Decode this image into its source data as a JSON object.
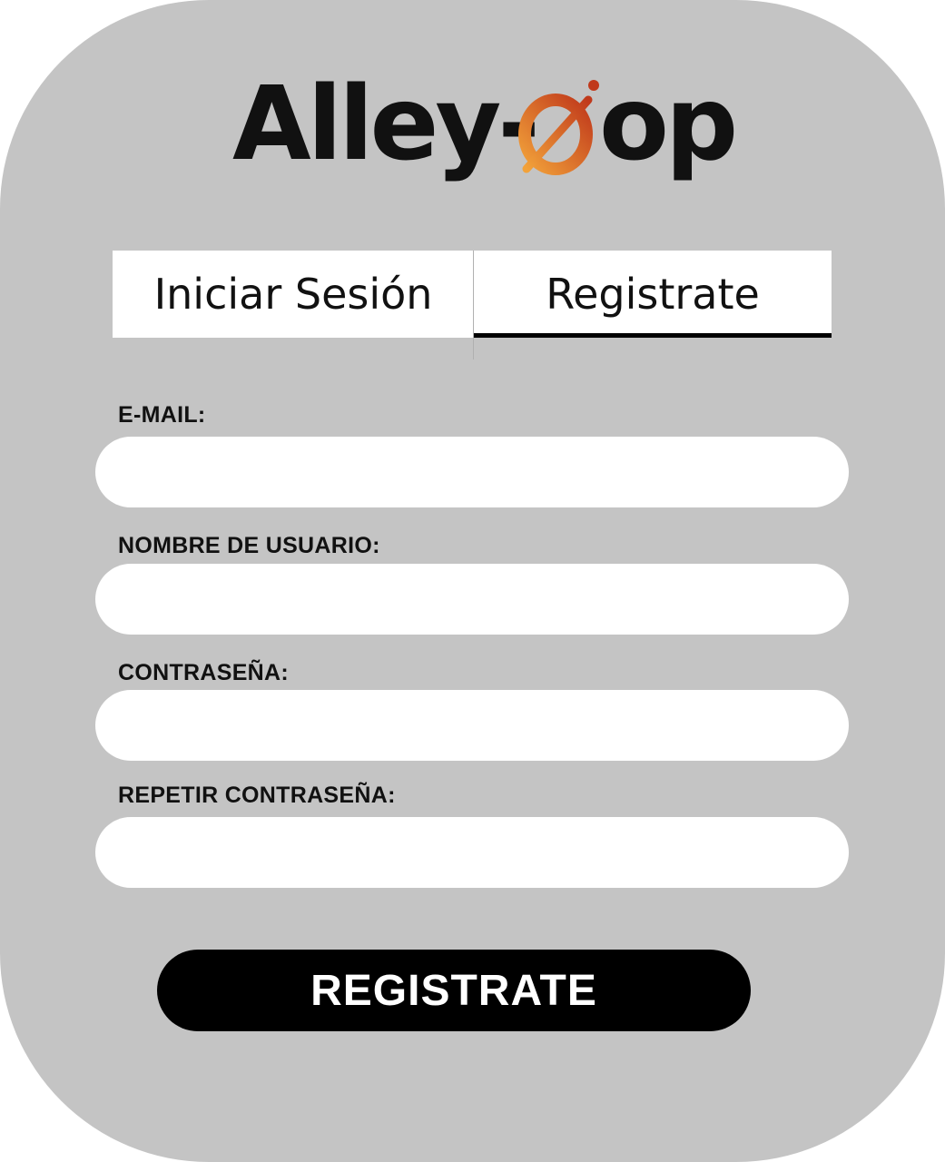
{
  "logo": {
    "left_text": "Alley-",
    "right_text": "op",
    "mark_icon": "basketball-swoosh-icon",
    "colors": {
      "text": "#111111",
      "accent_dark": "#c0391b",
      "accent_light": "#f2a23a"
    }
  },
  "tabs": [
    {
      "label": "Iniciar Sesión",
      "active": false
    },
    {
      "label": "Registrate",
      "active": true
    }
  ],
  "form": {
    "fields": [
      {
        "label": "E-MAIL:",
        "value": "",
        "placeholder": ""
      },
      {
        "label": "NOMBRE DE USUARIO:",
        "value": "",
        "placeholder": ""
      },
      {
        "label": "CONTRASEÑA:",
        "value": "",
        "placeholder": ""
      },
      {
        "label": "REPETIR CONTRASEÑA:",
        "value": "",
        "placeholder": ""
      }
    ],
    "submit_label": "REGISTRATE"
  },
  "colors": {
    "card_background": "#c4c4c4",
    "input_background": "#ffffff",
    "button_background": "#000000",
    "button_text": "#ffffff"
  }
}
